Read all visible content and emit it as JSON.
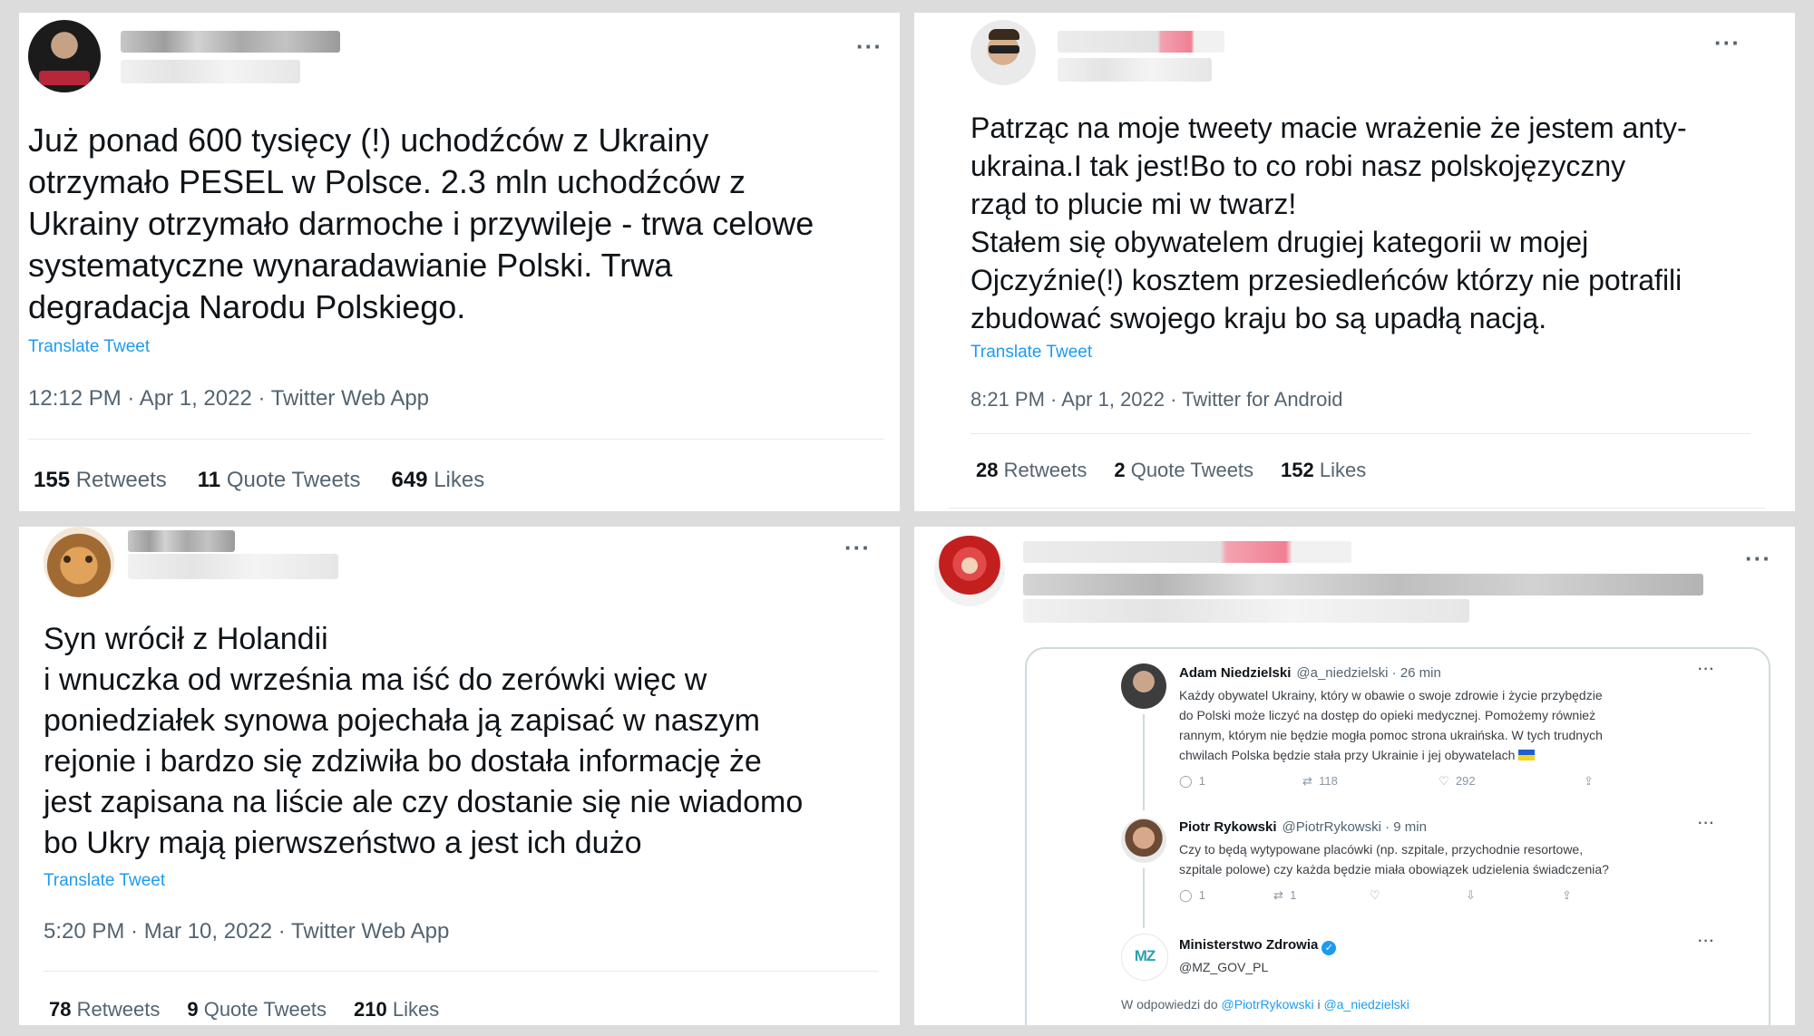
{
  "tweets": [
    {
      "text": "Już ponad 600 tysięcy (!) uchodźców z Ukrainy\notrzymało PESEL w Polsce. 2.3 mln uchodźców z\nUkrainy otrzymało darmoche i przywileje - trwa celowe\nsystematyczne wynaradawianie Polski. Trwa\ndegradacja Narodu Polskiego.",
      "translate": "Translate Tweet",
      "meta": "12:12 PM · Apr 1, 2022 · Twitter Web App",
      "retweets": "155",
      "retweets_label": "Retweets",
      "quotes": "11",
      "quotes_label": "Quote Tweets",
      "likes": "649",
      "likes_label": "Likes",
      "more": "···"
    },
    {
      "text": "Patrząc na moje tweety macie wrażenie że jestem anty-\nukraina.I tak jest!Bo to co robi nasz polskojęzyczny\nrząd to plucie mi w twarz!\nStałem się obywatelem drugiej kategorii w mojej\nOjczyźnie(!) kosztem przesiedleńców którzy nie potrafili\nzbudować swojego kraju bo są upadłą nacją.",
      "translate": "Translate Tweet",
      "meta": "8:21 PM · Apr 1, 2022 · Twitter for Android",
      "retweets": "28",
      "retweets_label": "Retweets",
      "quotes": "2",
      "quotes_label": "Quote Tweets",
      "likes": "152",
      "likes_label": "Likes",
      "more": "···"
    },
    {
      "text": "Syn  wrócił z Holandii\n i wnuczka od września ma iść do zerówki więc w\nponiedziałek synowa pojechała ją zapisać w naszym\nrejonie i bardzo się zdziwiła bo dostała informację że\njest zapisana na liście ale czy dostanie się nie wiadomo\nbo Ukry mają pierwszeństwo a jest ich dużo",
      "translate": "Translate Tweet",
      "meta": "5:20 PM · Mar 10, 2022 · Twitter Web App",
      "retweets": "78",
      "retweets_label": "Retweets",
      "quotes": "9",
      "quotes_label": "Quote Tweets",
      "likes": "210",
      "likes_label": "Likes",
      "more": "···"
    },
    {
      "more": "···",
      "embedded": [
        {
          "name": "Adam Niedzielski",
          "handle": "@a_niedzielski · 26 min",
          "text": "Każdy obywatel Ukrainy, który w obawie o swoje zdrowie i życie przybędzie\ndo Polski może liczyć na dostęp do opieki medycznej. Pomożemy również\nrannym, którym nie będzie mogła pomoc strona ukraińska. W tych trudnych\nchwilach Polska będzie stała przy Ukrainie i jej obywatelach",
          "replies": "1",
          "retweets": "118",
          "likes": "292",
          "more": "···"
        },
        {
          "name": "Piotr Rykowski",
          "handle": "@PiotrRykowski · 9 min",
          "text": "Czy to będą wytypowane placówki (np. szpitale, przychodnie resortowe,\nszpitale polowe) czy każda będzie miała obowiązek udzielenia świadczenia?",
          "replies": "1",
          "retweets": "1",
          "more": "···"
        },
        {
          "name": "Ministerstwo Zdrowia",
          "handle": "@MZ_GOV_PL",
          "logo": "MZ",
          "more": "···",
          "reply_prefix": "W odpowiedzi do",
          "reply_link1": "@PiotrRykowski",
          "reply_and": "i",
          "reply_link2": "@a_niedzielski"
        }
      ]
    }
  ],
  "icons": [
    "more-icon",
    "reply-icon",
    "retweet-icon",
    "like-icon",
    "share-icon",
    "verified-icon",
    "ukraine-flag-icon"
  ],
  "colors": {
    "link": "#1d9bf0",
    "muted": "#536471",
    "text": "#0f1419",
    "background": "#dcdcdc"
  }
}
